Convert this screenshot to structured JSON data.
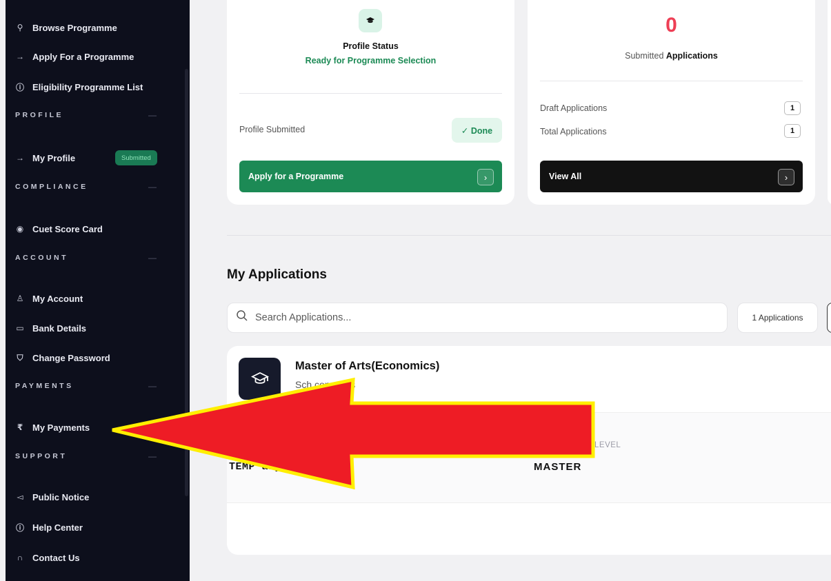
{
  "sidebar": {
    "items": [
      {
        "icon": "search-icon",
        "glyph": "⚲",
        "label": "Browse Programme"
      },
      {
        "icon": "arrow-right-icon",
        "glyph": "→",
        "label": "Apply For a Programme"
      },
      {
        "icon": "info-icon",
        "glyph": "ⓘ",
        "label": "Eligibility Programme List"
      },
      {
        "icon": "arrow-right-icon",
        "glyph": "→",
        "label": "My Profile"
      },
      {
        "icon": "eye-icon",
        "glyph": "◉",
        "label": "Cuet Score Card"
      },
      {
        "icon": "user-icon",
        "glyph": "♙",
        "label": "My Account"
      },
      {
        "icon": "bank-icon",
        "glyph": "▭",
        "label": "Bank Details"
      },
      {
        "icon": "shield-icon",
        "glyph": "⛉",
        "label": "Change Password"
      },
      {
        "icon": "rupee-icon",
        "glyph": "₹",
        "label": "My Payments"
      },
      {
        "icon": "megaphone-icon",
        "glyph": "◅",
        "label": "Public Notice"
      },
      {
        "icon": "info-icon",
        "glyph": "ⓘ",
        "label": "Help Center"
      },
      {
        "icon": "headset-icon",
        "glyph": "∩",
        "label": "Contact Us"
      }
    ],
    "sections": [
      "PROFILE",
      "COMPLIANCE",
      "ACCOUNT",
      "PAYMENTS",
      "SUPPORT"
    ],
    "section_toggle": "—",
    "profile_badge": "Submitted"
  },
  "profile_card": {
    "icon": "graduation-cap-icon",
    "title": "Profile Status",
    "status": "Ready for Programme Selection",
    "row_label": "Profile Submitted",
    "done_label": "✓ Done",
    "button_label": "Apply for a Programme",
    "button_arrow": "›"
  },
  "apps_card": {
    "count": "0",
    "subtitle_prefix": "Submitted",
    "subtitle_bold": "Applications",
    "rows": [
      {
        "label": "Draft Applications",
        "value": "1"
      },
      {
        "label": "Total Applications",
        "value": "1"
      }
    ],
    "button_label": "View All",
    "button_arrow": "›"
  },
  "my_applications": {
    "heading": "My Applications",
    "search_placeholder": "Search Applications...",
    "count_label": "1 Applications",
    "app": {
      "title": "Master of Arts(Economics)",
      "subtitle": "Sch          conomics",
      "level_label": "LEVEL",
      "level_value": "MASTER",
      "temp_value": "TEMP          ary]"
    }
  },
  "colors": {
    "sidebar_bg": "#0d0f1c",
    "accent_green": "#1c8a55",
    "count_red": "#ee3f55",
    "annotation_arrow": "#ee1c25",
    "annotation_outline": "#ffee00"
  }
}
